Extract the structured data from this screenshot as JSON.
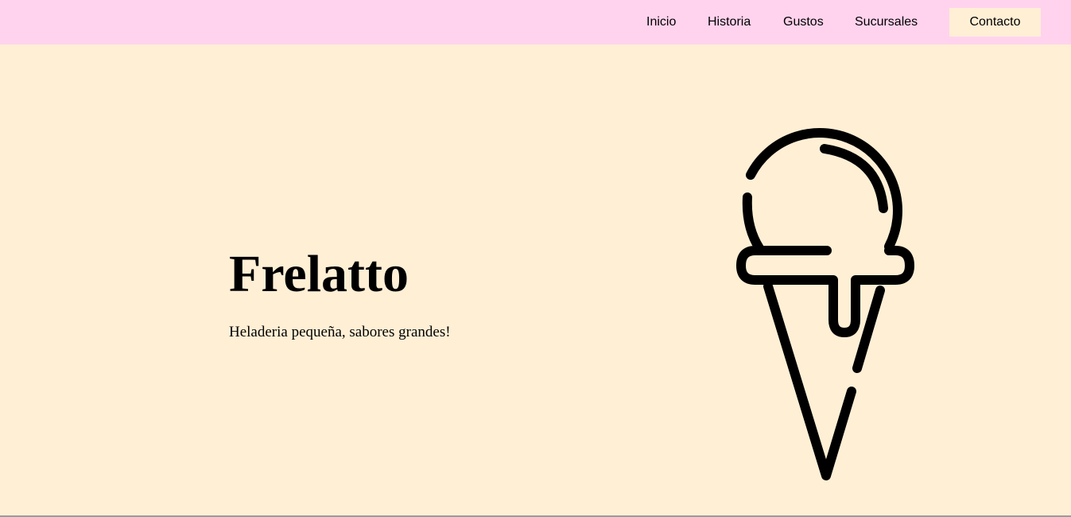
{
  "nav": {
    "items": [
      {
        "label": "Inicio"
      },
      {
        "label": "Historia"
      },
      {
        "label": "Gustos"
      },
      {
        "label": "Sucursales"
      }
    ],
    "contact_label": "Contacto"
  },
  "hero": {
    "title": "Frelatto",
    "subtitle": "Heladeria pequeña, sabores grandes!",
    "icon": "ice-cream-cone-icon"
  },
  "colors": {
    "navbar_bg": "#ffd3ee",
    "page_bg": "#ffefd5",
    "contact_bg": "#ffefd5",
    "text": "#000000"
  }
}
